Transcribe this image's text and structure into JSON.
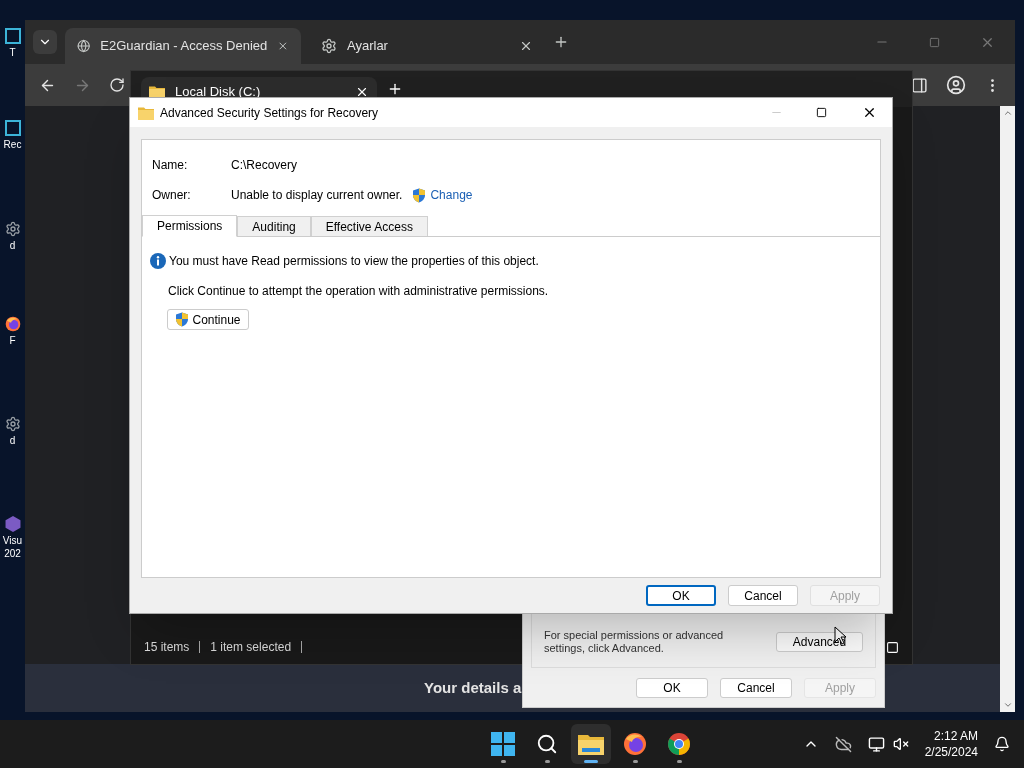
{
  "desktop": {
    "icons": [
      {
        "kind": "generic",
        "lines": [
          "T"
        ]
      },
      {
        "kind": "generic",
        "lines": [
          "Rec"
        ]
      },
      {
        "kind": "gear",
        "lines": [
          "d"
        ]
      },
      {
        "kind": "firefox",
        "lines": [
          "F"
        ]
      },
      {
        "kind": "gear",
        "lines": [
          "d"
        ]
      },
      {
        "kind": "vs",
        "lines": [
          "Visu",
          "202"
        ]
      }
    ]
  },
  "browser": {
    "tabs": [
      {
        "title": "E2Guardian - Access Denied",
        "kind": "globe",
        "selected": true
      },
      {
        "title": "Ayarlar",
        "kind": "gear",
        "selected": false
      }
    ],
    "page_text": "Your details a"
  },
  "explorer": {
    "tab_title": "Local Disk (C:)",
    "status": [
      "15 items",
      "1 item selected"
    ]
  },
  "properties": {
    "note": "For special permissions or advanced settings, click Advanced.",
    "advanced_button": "Advanced",
    "buttons": [
      {
        "label": "OK",
        "disabled": false
      },
      {
        "label": "Cancel",
        "disabled": false
      },
      {
        "label": "Apply",
        "disabled": true
      }
    ]
  },
  "dialog": {
    "title": "Advanced Security Settings for Recovery",
    "name_label": "Name:",
    "name_value": "C:\\Recovery",
    "owner_label": "Owner:",
    "owner_value": "Unable to display current owner.",
    "change_link": "Change",
    "tabs": [
      {
        "label": "Permissions",
        "selected": true
      },
      {
        "label": "Auditing",
        "selected": false
      },
      {
        "label": "Effective Access",
        "selected": false
      }
    ],
    "info": "You must have Read permissions to view the properties of this object.",
    "instruction": "Click Continue to attempt the operation with administrative permissions.",
    "continue_button": "Continue",
    "buttons": [
      {
        "label": "OK",
        "default": true,
        "disabled": false
      },
      {
        "label": "Cancel",
        "default": false,
        "disabled": false
      },
      {
        "label": "Apply",
        "default": false,
        "disabled": true
      }
    ]
  },
  "taskbar": {
    "apps": [
      {
        "kind": "start",
        "active": false
      },
      {
        "kind": "search",
        "active": false
      },
      {
        "kind": "explorer",
        "active": true
      },
      {
        "kind": "firefox",
        "active": false
      },
      {
        "kind": "chrome",
        "active": false
      }
    ],
    "time": "2:12 AM",
    "date": "2/25/2024"
  }
}
